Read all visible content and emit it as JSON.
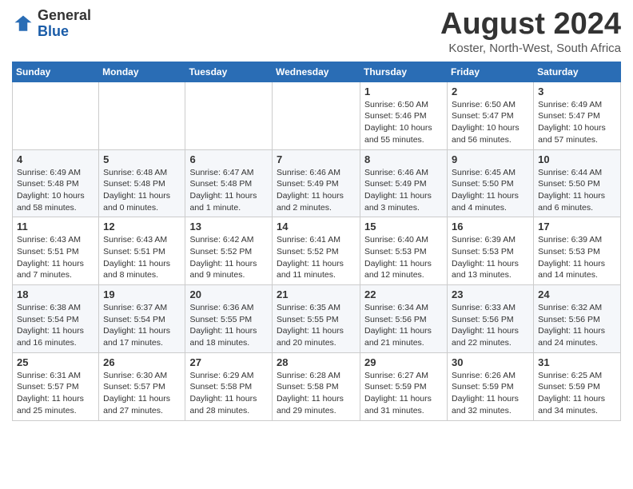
{
  "header": {
    "logo_general": "General",
    "logo_blue": "Blue",
    "month_title": "August 2024",
    "location": "Koster, North-West, South Africa"
  },
  "days_of_week": [
    "Sunday",
    "Monday",
    "Tuesday",
    "Wednesday",
    "Thursday",
    "Friday",
    "Saturday"
  ],
  "weeks": [
    [
      {
        "day": "",
        "info": ""
      },
      {
        "day": "",
        "info": ""
      },
      {
        "day": "",
        "info": ""
      },
      {
        "day": "",
        "info": ""
      },
      {
        "day": "1",
        "info": "Sunrise: 6:50 AM\nSunset: 5:46 PM\nDaylight: 10 hours\nand 55 minutes."
      },
      {
        "day": "2",
        "info": "Sunrise: 6:50 AM\nSunset: 5:47 PM\nDaylight: 10 hours\nand 56 minutes."
      },
      {
        "day": "3",
        "info": "Sunrise: 6:49 AM\nSunset: 5:47 PM\nDaylight: 10 hours\nand 57 minutes."
      }
    ],
    [
      {
        "day": "4",
        "info": "Sunrise: 6:49 AM\nSunset: 5:48 PM\nDaylight: 10 hours\nand 58 minutes."
      },
      {
        "day": "5",
        "info": "Sunrise: 6:48 AM\nSunset: 5:48 PM\nDaylight: 11 hours\nand 0 minutes."
      },
      {
        "day": "6",
        "info": "Sunrise: 6:47 AM\nSunset: 5:48 PM\nDaylight: 11 hours\nand 1 minute."
      },
      {
        "day": "7",
        "info": "Sunrise: 6:46 AM\nSunset: 5:49 PM\nDaylight: 11 hours\nand 2 minutes."
      },
      {
        "day": "8",
        "info": "Sunrise: 6:46 AM\nSunset: 5:49 PM\nDaylight: 11 hours\nand 3 minutes."
      },
      {
        "day": "9",
        "info": "Sunrise: 6:45 AM\nSunset: 5:50 PM\nDaylight: 11 hours\nand 4 minutes."
      },
      {
        "day": "10",
        "info": "Sunrise: 6:44 AM\nSunset: 5:50 PM\nDaylight: 11 hours\nand 6 minutes."
      }
    ],
    [
      {
        "day": "11",
        "info": "Sunrise: 6:43 AM\nSunset: 5:51 PM\nDaylight: 11 hours\nand 7 minutes."
      },
      {
        "day": "12",
        "info": "Sunrise: 6:43 AM\nSunset: 5:51 PM\nDaylight: 11 hours\nand 8 minutes."
      },
      {
        "day": "13",
        "info": "Sunrise: 6:42 AM\nSunset: 5:52 PM\nDaylight: 11 hours\nand 9 minutes."
      },
      {
        "day": "14",
        "info": "Sunrise: 6:41 AM\nSunset: 5:52 PM\nDaylight: 11 hours\nand 11 minutes."
      },
      {
        "day": "15",
        "info": "Sunrise: 6:40 AM\nSunset: 5:53 PM\nDaylight: 11 hours\nand 12 minutes."
      },
      {
        "day": "16",
        "info": "Sunrise: 6:39 AM\nSunset: 5:53 PM\nDaylight: 11 hours\nand 13 minutes."
      },
      {
        "day": "17",
        "info": "Sunrise: 6:39 AM\nSunset: 5:53 PM\nDaylight: 11 hours\nand 14 minutes."
      }
    ],
    [
      {
        "day": "18",
        "info": "Sunrise: 6:38 AM\nSunset: 5:54 PM\nDaylight: 11 hours\nand 16 minutes."
      },
      {
        "day": "19",
        "info": "Sunrise: 6:37 AM\nSunset: 5:54 PM\nDaylight: 11 hours\nand 17 minutes."
      },
      {
        "day": "20",
        "info": "Sunrise: 6:36 AM\nSunset: 5:55 PM\nDaylight: 11 hours\nand 18 minutes."
      },
      {
        "day": "21",
        "info": "Sunrise: 6:35 AM\nSunset: 5:55 PM\nDaylight: 11 hours\nand 20 minutes."
      },
      {
        "day": "22",
        "info": "Sunrise: 6:34 AM\nSunset: 5:56 PM\nDaylight: 11 hours\nand 21 minutes."
      },
      {
        "day": "23",
        "info": "Sunrise: 6:33 AM\nSunset: 5:56 PM\nDaylight: 11 hours\nand 22 minutes."
      },
      {
        "day": "24",
        "info": "Sunrise: 6:32 AM\nSunset: 5:56 PM\nDaylight: 11 hours\nand 24 minutes."
      }
    ],
    [
      {
        "day": "25",
        "info": "Sunrise: 6:31 AM\nSunset: 5:57 PM\nDaylight: 11 hours\nand 25 minutes."
      },
      {
        "day": "26",
        "info": "Sunrise: 6:30 AM\nSunset: 5:57 PM\nDaylight: 11 hours\nand 27 minutes."
      },
      {
        "day": "27",
        "info": "Sunrise: 6:29 AM\nSunset: 5:58 PM\nDaylight: 11 hours\nand 28 minutes."
      },
      {
        "day": "28",
        "info": "Sunrise: 6:28 AM\nSunset: 5:58 PM\nDaylight: 11 hours\nand 29 minutes."
      },
      {
        "day": "29",
        "info": "Sunrise: 6:27 AM\nSunset: 5:59 PM\nDaylight: 11 hours\nand 31 minutes."
      },
      {
        "day": "30",
        "info": "Sunrise: 6:26 AM\nSunset: 5:59 PM\nDaylight: 11 hours\nand 32 minutes."
      },
      {
        "day": "31",
        "info": "Sunrise: 6:25 AM\nSunset: 5:59 PM\nDaylight: 11 hours\nand 34 minutes."
      }
    ]
  ]
}
